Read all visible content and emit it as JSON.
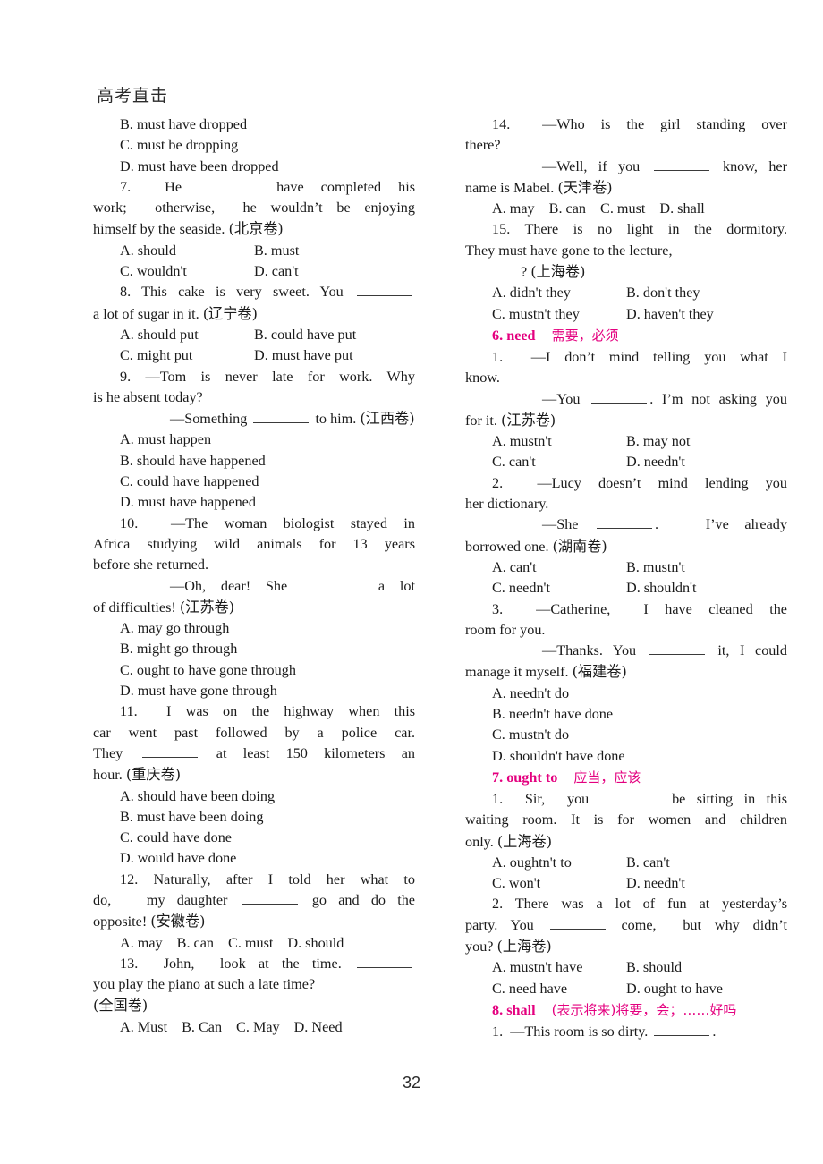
{
  "page": {
    "number": "32",
    "section_title": "高考直击",
    "accent_color": "#e4007f",
    "text_color": "#1b1b1b"
  },
  "left_column": {
    "carryover_options": [
      "B. must have dropped",
      "C. must be dropping",
      "D. must have been dropped"
    ],
    "items": [
      {
        "number": "7.",
        "stem_pre": "7.  He",
        "stem_post": "have completed his work; otherwise, he wouldn't be enjoying himself by the seaside. (北京卷)",
        "lines": [
          "7.  He ______ have completed his",
          "work; otherwise, he wouldn't be enjoying",
          "himself by the seaside. (北京卷)"
        ],
        "options_layout": "2col",
        "options": [
          "A. should",
          "B. must",
          "C. wouldn't",
          "D. can't"
        ]
      },
      {
        "number": "8.",
        "lines": [
          "8. This cake is very sweet. You ______",
          "a lot of sugar in it. (辽宁卷)"
        ],
        "options_layout": "2col",
        "options": [
          "A. should put",
          "B. could have put",
          "C. might put",
          "D. must have put"
        ]
      },
      {
        "number": "9.",
        "lines": [
          "9. —Tom is never late for work. Why",
          "is he absent today?",
          "—Something ______ to him. (江西卷)"
        ],
        "options_layout": "stacked",
        "options": [
          "A. must happen",
          "B. should have happened",
          "C. could have happened",
          "D. must have happened"
        ]
      },
      {
        "number": "10.",
        "lines": [
          "10.  —The woman biologist stayed in",
          "Africa studying wild animals for 13 years",
          "before she returned.",
          "—Oh, dear! She ______ a lot",
          "of difficulties! (江苏卷)"
        ],
        "options_layout": "stacked",
        "options": [
          "A. may go through",
          "B. might go through",
          "C. ought to have gone through",
          "D. must have gone through"
        ]
      },
      {
        "number": "11.",
        "lines": [
          "11.  I was on the highway when this",
          "car went past followed by a police car.",
          "They ______ at least 150 kilometers an",
          "hour. (重庆卷)"
        ],
        "options_layout": "stacked",
        "options": [
          "A. should have been doing",
          "B. must have been doing",
          "C. could have done",
          "D. would have done"
        ]
      },
      {
        "number": "12.",
        "lines": [
          "12. Naturally, after I told her what to",
          "do,  my daughter ______ go and do the",
          "opposite! (安徽卷)"
        ],
        "options_layout": "4col",
        "options": [
          "A. may",
          "B. can",
          "C. must",
          "D. should"
        ]
      },
      {
        "number": "13.",
        "lines": [
          "13.  John,  look at the time. ______",
          "you play the piano at such a late time?",
          "(全国卷)"
        ],
        "options_layout": "4col",
        "options": [
          "A. Must",
          "B. Can",
          "C. May",
          "D. Need"
        ]
      }
    ]
  },
  "right_column": {
    "items": [
      {
        "number": "14.",
        "lines": [
          "14.  —Who is the girl standing over",
          "there?",
          "—Well, if you ______ know, her",
          "name is Mabel. (天津卷)"
        ],
        "options_layout": "4col",
        "options": [
          "A. may",
          "B. can",
          "C. must",
          "D. shall"
        ]
      },
      {
        "number": "15.",
        "lines": [
          "15. There is no light in the dormitory.",
          "They must have gone to the lecture,",
          "______? (上海卷)"
        ],
        "options_layout": "2col",
        "options": [
          "A. didn't they",
          "B. don't they",
          "C. mustn't they",
          "D. haven't they"
        ]
      }
    ],
    "sections": [
      {
        "id": "need",
        "heading_en": "6. need",
        "heading_cn": "需要，必须",
        "items": [
          {
            "number": "1.",
            "lines": [
              "1.  —I don't mind telling you what I",
              "know.",
              "—You ______. I'm not asking you",
              "for it. (江苏卷)"
            ],
            "options_layout": "2col",
            "options": [
              "A. mustn't",
              "B. may not",
              "C. can't",
              "D. needn't"
            ]
          },
          {
            "number": "2.",
            "lines": [
              "2.  —Lucy doesn't mind lending you",
              "her dictionary.",
              "—She ______.  I've already",
              "borrowed one. (湖南卷)"
            ],
            "options_layout": "2col",
            "options": [
              "A. can't",
              "B. mustn't",
              "C. needn't",
              "D. shouldn't"
            ]
          },
          {
            "number": "3.",
            "lines": [
              "3.  —Catherine,  I have cleaned the",
              "room for you.",
              "—Thanks. You ______ it, I could",
              "manage it myself. (福建卷)"
            ],
            "options_layout": "stacked",
            "options": [
              "A. needn't do",
              "B. needn't have done",
              "C. mustn't do",
              "D. shouldn't have done"
            ]
          }
        ]
      },
      {
        "id": "ought-to",
        "heading_en": "7. ought to",
        "heading_cn": "应当，应该",
        "items": [
          {
            "number": "1.",
            "lines": [
              "1.  Sir,  you ______ be sitting in this",
              "waiting room. It is for women and children",
              "only. (上海卷)"
            ],
            "options_layout": "2col",
            "options": [
              "A. oughtn't to",
              "B. can't",
              "C. won't",
              "D. needn't"
            ]
          },
          {
            "number": "2.",
            "lines": [
              "2. There was a lot of fun at yesterday's",
              "party. You ______ come,  but why didn't",
              "you? (上海卷)"
            ],
            "options_layout": "2col",
            "options": [
              "A. mustn't have",
              "B. should",
              "C. need have",
              "D. ought to have"
            ]
          }
        ]
      },
      {
        "id": "shall",
        "heading_en": "8. shall",
        "heading_cn": "(表示将来)将要，会；……好吗",
        "items": [
          {
            "number": "1.",
            "lines": [
              "1.  —This room is so dirty. ______."
            ],
            "options_layout": "none",
            "options": []
          }
        ]
      }
    ]
  }
}
